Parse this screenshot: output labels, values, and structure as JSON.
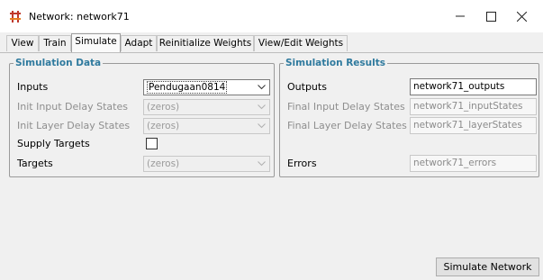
{
  "window": {
    "title": "Network: network71",
    "icon": "matlab-network-icon",
    "controls": [
      "minimize-icon",
      "maximize-icon",
      "close-icon"
    ]
  },
  "tabs": [
    {
      "label": "View",
      "active": false
    },
    {
      "label": "Train",
      "active": false
    },
    {
      "label": "Simulate",
      "active": true
    },
    {
      "label": "Adapt",
      "active": false
    },
    {
      "label": "Reinitialize Weights",
      "active": false
    },
    {
      "label": "View/Edit Weights",
      "active": false
    }
  ],
  "simulation_data": {
    "title": "Simulation Data",
    "inputs": {
      "label": "Inputs",
      "value": "Pendugaan0814"
    },
    "init_input_delay": {
      "label": "Init Input Delay States",
      "value": "(zeros)"
    },
    "init_layer_delay": {
      "label": "Init Layer Delay States",
      "value": "(zeros)"
    },
    "supply_targets": {
      "label": "Supply Targets",
      "checked": false
    },
    "targets": {
      "label": "Targets",
      "value": "(zeros)"
    }
  },
  "simulation_results": {
    "title": "Simulation Results",
    "outputs": {
      "label": "Outputs",
      "value": "network71_outputs"
    },
    "final_input_delay": {
      "label": "Final Input Delay States",
      "value": "network71_inputStates"
    },
    "final_layer_delay": {
      "label": "Final Layer Delay States",
      "value": "network71_layerStates"
    },
    "errors": {
      "label": "Errors",
      "value": "network71_errors"
    }
  },
  "actions": {
    "simulate_label": "Simulate Network"
  },
  "colors": {
    "section_title": "#2f7a9e",
    "disabled_text": "#8e8e8e"
  }
}
